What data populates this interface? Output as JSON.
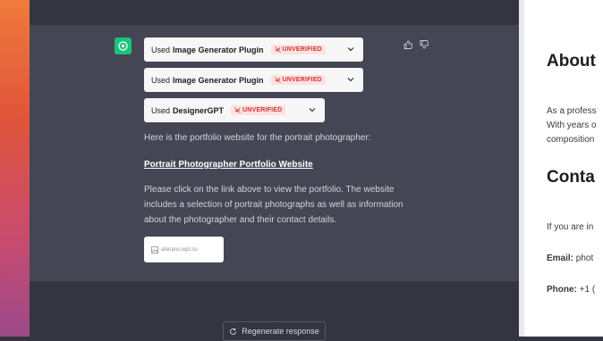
{
  "chat": {
    "plugins": [
      {
        "prefix": "Used",
        "name": "Image Generator Plugin",
        "badge": "UNVERIFIED"
      },
      {
        "prefix": "Used",
        "name": "Image Generator Plugin",
        "badge": "UNVERIFIED"
      },
      {
        "prefix": "Used",
        "name": "DesignerGPT",
        "badge": "UNVERIFIED"
      }
    ],
    "intro": "Here is the portfolio website for the portrait photographer:",
    "link_text": "Portrait Photographer Portfolio Website",
    "body": "Please click on the link above to view the portfolio. The website includes a selection of portrait photographs as well as information about the photographer and their contact details.",
    "thumbnail_caption": "abinans.repl.co",
    "regenerate_label": "Regenerate response"
  },
  "preview": {
    "about_heading": "About",
    "about_line1": "As a profess",
    "about_line2": "With years o",
    "about_line3": "composition",
    "contact_heading": "Conta",
    "contact_intro": "If you are in",
    "email_label": "Email:",
    "email_value": "phot",
    "phone_label": "Phone:",
    "phone_value": "+1 ("
  },
  "colors": {
    "assistant_bg": "#444654",
    "chat_bg": "#343541",
    "accent": "#19c37d",
    "badge_text": "#d0342c",
    "badge_bg": "#fde2e1"
  },
  "icons": [
    "openai-logo-icon",
    "thumbs-up-icon",
    "thumbs-down-icon",
    "chevron-down-icon",
    "unverified-icon",
    "image-icon",
    "refresh-icon"
  ]
}
